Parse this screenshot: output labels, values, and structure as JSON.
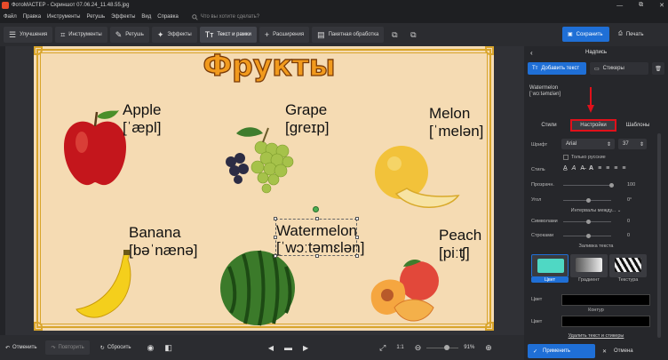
{
  "titlebar": {
    "title": "ФотоМАСТЕР - Скриншот 07.06.24_11.48.55.jpg",
    "minimize": "—",
    "restore": "⧉",
    "close": "✕"
  },
  "menu": [
    "Файл",
    "Правка",
    "Инструменты",
    "Ретушь",
    "Эффекты",
    "Вид",
    "Справка"
  ],
  "search": {
    "placeholder": "Что вы хотите сделать?"
  },
  "toolbar": [
    {
      "label": "Улучшения",
      "icon": "☰"
    },
    {
      "label": "Инструменты",
      "icon": "⌗"
    },
    {
      "label": "Ретушь",
      "icon": "✎"
    },
    {
      "label": "Эффекты",
      "icon": "✦"
    },
    {
      "label": "Текст и рамки",
      "icon": "Tт"
    },
    {
      "label": "Расширения",
      "icon": "+"
    },
    {
      "label": "Пакетная обработка",
      "icon": "▤"
    }
  ],
  "save_label": "Сохранить",
  "print_label": "Печать",
  "card": {
    "title": "Фрукты",
    "apple": [
      "Apple",
      "[ˈæpl]"
    ],
    "grape": [
      "Grape",
      "[greɪp]"
    ],
    "melon": [
      "Melon",
      "[ˈmelən]"
    ],
    "banana": [
      "Banana",
      "[bəˈnænə]"
    ],
    "watermelon": [
      "Watermelon",
      "[ˈwɔːtəmɛlən]"
    ],
    "peach": [
      "Peach",
      "[piːʧ]"
    ]
  },
  "bottom": {
    "undo": "Отменить",
    "redo": "Повторить",
    "reset": "Сбросить",
    "ratio": "1:1",
    "zoom": "91%"
  },
  "panel": {
    "title": "Надпись",
    "tab_add": "Добавить текст",
    "tab_stickers": "Стикеры",
    "preview_line1": "Watermelon",
    "preview_line2": "[ˈwɔːtəmɛlən]",
    "subtabs": [
      "Стили",
      "Настройки",
      "Шаблоны"
    ],
    "font_label": "Шрифт",
    "font_value": "Arial",
    "font_size": "37",
    "only_russian": "Только русские",
    "style_label": "Стиль",
    "style_buttons": [
      "A̲",
      "A",
      "A̶",
      "A",
      "≡",
      "≡",
      "≡",
      "≡"
    ],
    "opacity_label": "Прозрачн.",
    "opacity_value": "100",
    "angle_label": "Угол",
    "angle_value": "0°",
    "intervals": "Интервалы между...",
    "symbols_label": "Символами",
    "symbols_value": "0",
    "lines_label": "Строками",
    "lines_value": "0",
    "fill_section": "Заливка текста",
    "fill_options": [
      "Цвет",
      "Градиент",
      "Текстура"
    ],
    "color_label": "Цвет",
    "outline_section": "Контур",
    "color2_label": "Цвет",
    "delete_link": "Удалить текст и стикеры",
    "apply": "Применить",
    "cancel": "Отмена"
  }
}
